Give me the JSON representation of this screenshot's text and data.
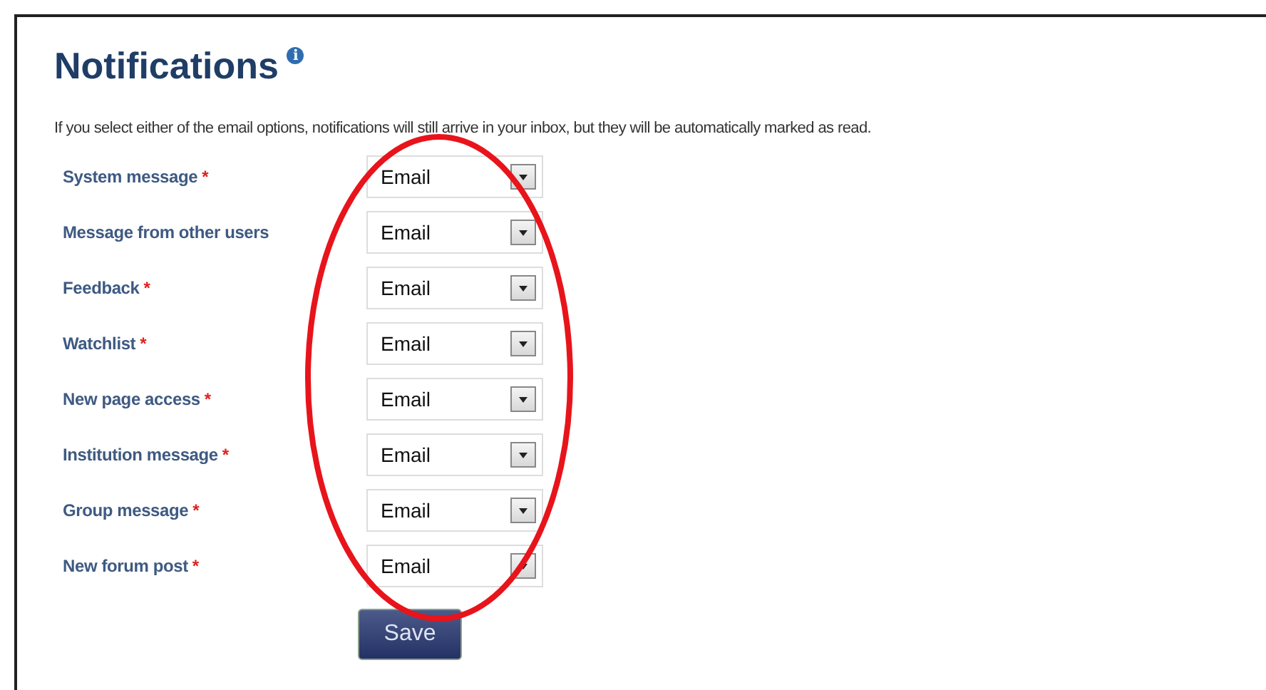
{
  "title": "Notifications",
  "info_icon": "i",
  "description": "If you select either of the email options, notifications will still arrive in your inbox, but they will be automatically marked as read.",
  "settings": [
    {
      "label": "System message",
      "required": true,
      "value": "Email"
    },
    {
      "label": "Message from other users",
      "required": false,
      "value": "Email"
    },
    {
      "label": "Feedback",
      "required": true,
      "value": "Email"
    },
    {
      "label": "Watchlist",
      "required": true,
      "value": "Email"
    },
    {
      "label": "New page access",
      "required": true,
      "value": "Email"
    },
    {
      "label": "Institution message",
      "required": true,
      "value": "Email"
    },
    {
      "label": "Group message",
      "required": true,
      "value": "Email"
    },
    {
      "label": "New forum post",
      "required": true,
      "value": "Email"
    }
  ],
  "save_button": "Save",
  "required_mark": "*"
}
